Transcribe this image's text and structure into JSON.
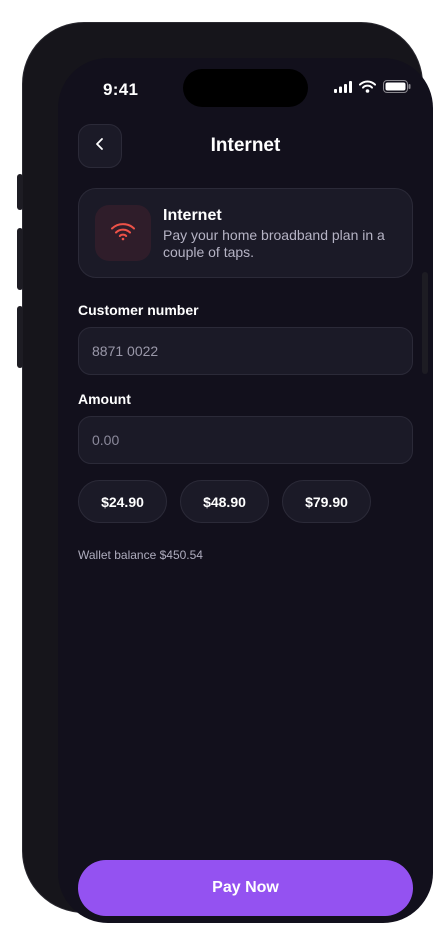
{
  "status_bar": {
    "time": "9:41",
    "icons": [
      "cellular-signal-icon",
      "wifi-icon",
      "battery-icon"
    ]
  },
  "header": {
    "back_icon": "chevron-left-icon",
    "title": "Internet"
  },
  "biller": {
    "icon": "wifi-icon",
    "name": "Internet",
    "description": "Pay your home broadband plan in a couple of taps."
  },
  "form": {
    "customer_number": {
      "label": "Customer number",
      "value": "8871 0022"
    },
    "amount": {
      "label": "Amount",
      "placeholder": "0.00"
    }
  },
  "quick_amounts": [
    "$24.90",
    "$48.90",
    "$79.90"
  ],
  "wallet_balance": "Wallet balance $450.54",
  "pay_button": {
    "label": "Pay Now"
  },
  "colors": {
    "background": "#12101c",
    "card": "#1b1a27",
    "accent": "#9452f1",
    "icon_tint": "#ee5248"
  }
}
